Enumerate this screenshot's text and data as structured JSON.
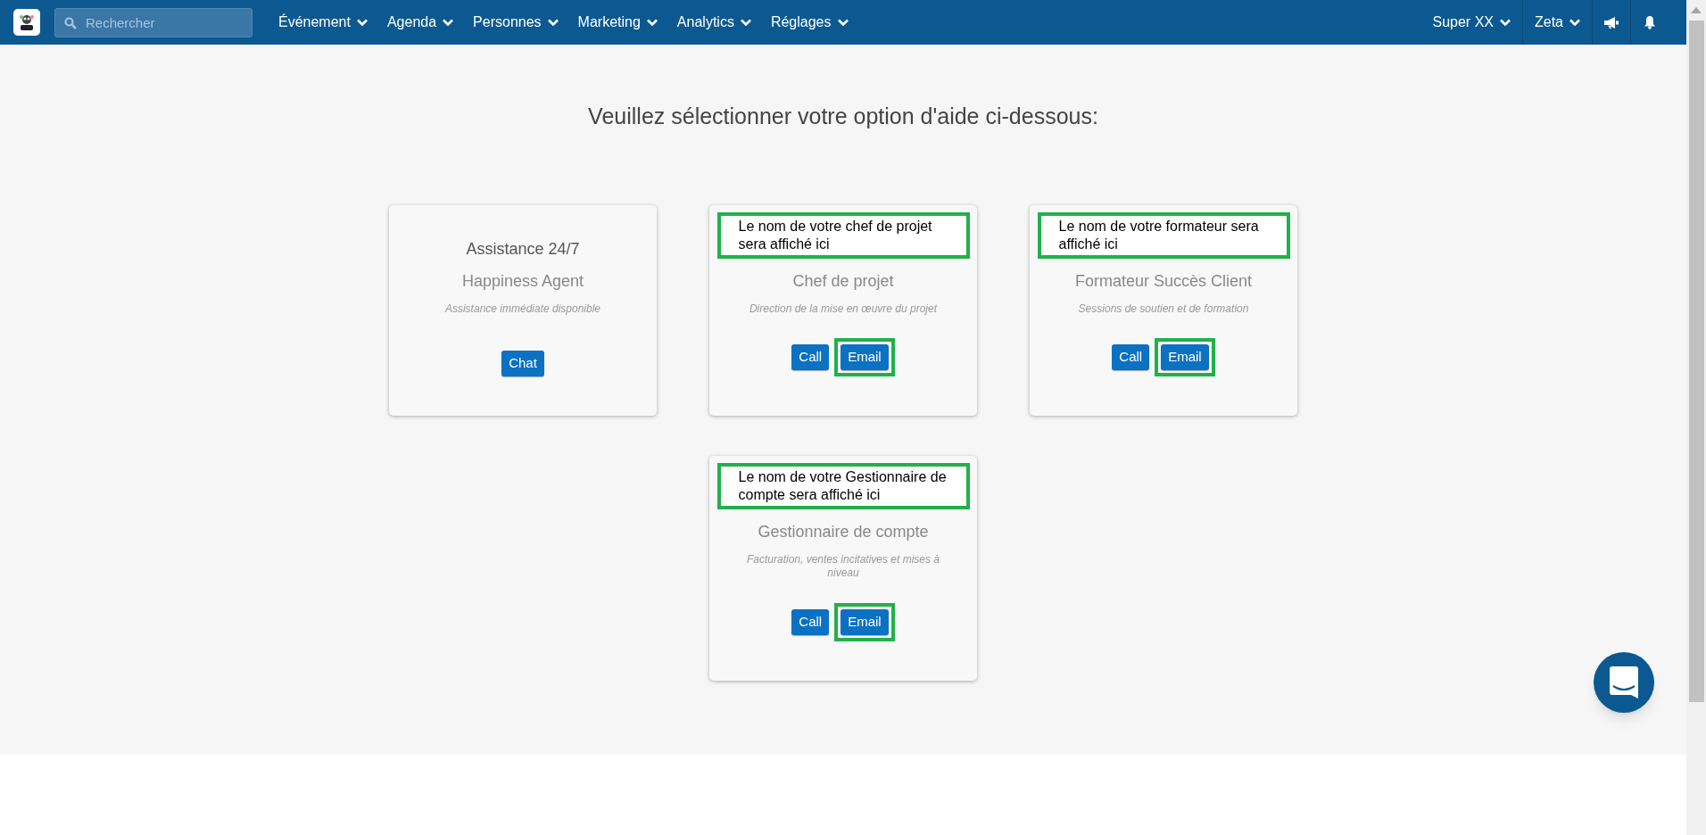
{
  "navbar": {
    "search": {
      "placeholder": "Rechercher"
    },
    "menus": [
      {
        "label": "Événement"
      },
      {
        "label": "Agenda"
      },
      {
        "label": "Personnes"
      },
      {
        "label": "Marketing"
      },
      {
        "label": "Analytics"
      },
      {
        "label": "Réglages"
      }
    ],
    "right_menus": [
      {
        "label": "Super XX"
      },
      {
        "label": "Zeta"
      }
    ]
  },
  "heading": "Veuillez sélectionner votre option d'aide ci-dessous:",
  "cards": [
    {
      "title": {
        "text": "Assistance 24/7",
        "annotated": false
      },
      "role": "Happiness Agent",
      "description": "Assistance immédiate disponible",
      "buttons": [
        {
          "label": "Chat",
          "highlighted": false
        }
      ]
    },
    {
      "title": {
        "text": "Le nom de votre chef de projet sera affiché ici",
        "annotated": true
      },
      "role": "Chef de projet",
      "description": "Direction de la mise en œuvre du projet",
      "buttons": [
        {
          "label": "Call",
          "highlighted": false
        },
        {
          "label": "Email",
          "highlighted": true
        }
      ]
    },
    {
      "title": {
        "text": "Le nom de votre formateur sera affiché ici",
        "annotated": true
      },
      "role": "Formateur Succès Client",
      "description": "Sessions de soutien et de formation",
      "buttons": [
        {
          "label": "Call",
          "highlighted": false
        },
        {
          "label": "Email",
          "highlighted": true
        }
      ]
    },
    {
      "title": {
        "text": "Le nom de votre Gestionnaire de compte sera affiché ici",
        "annotated": true
      },
      "role": "Gestionnaire de compte",
      "description": "Facturation, ventes incitatives et mises à niveau",
      "buttons": [
        {
          "label": "Call",
          "highlighted": false
        },
        {
          "label": "Email",
          "highlighted": true
        }
      ]
    }
  ]
}
